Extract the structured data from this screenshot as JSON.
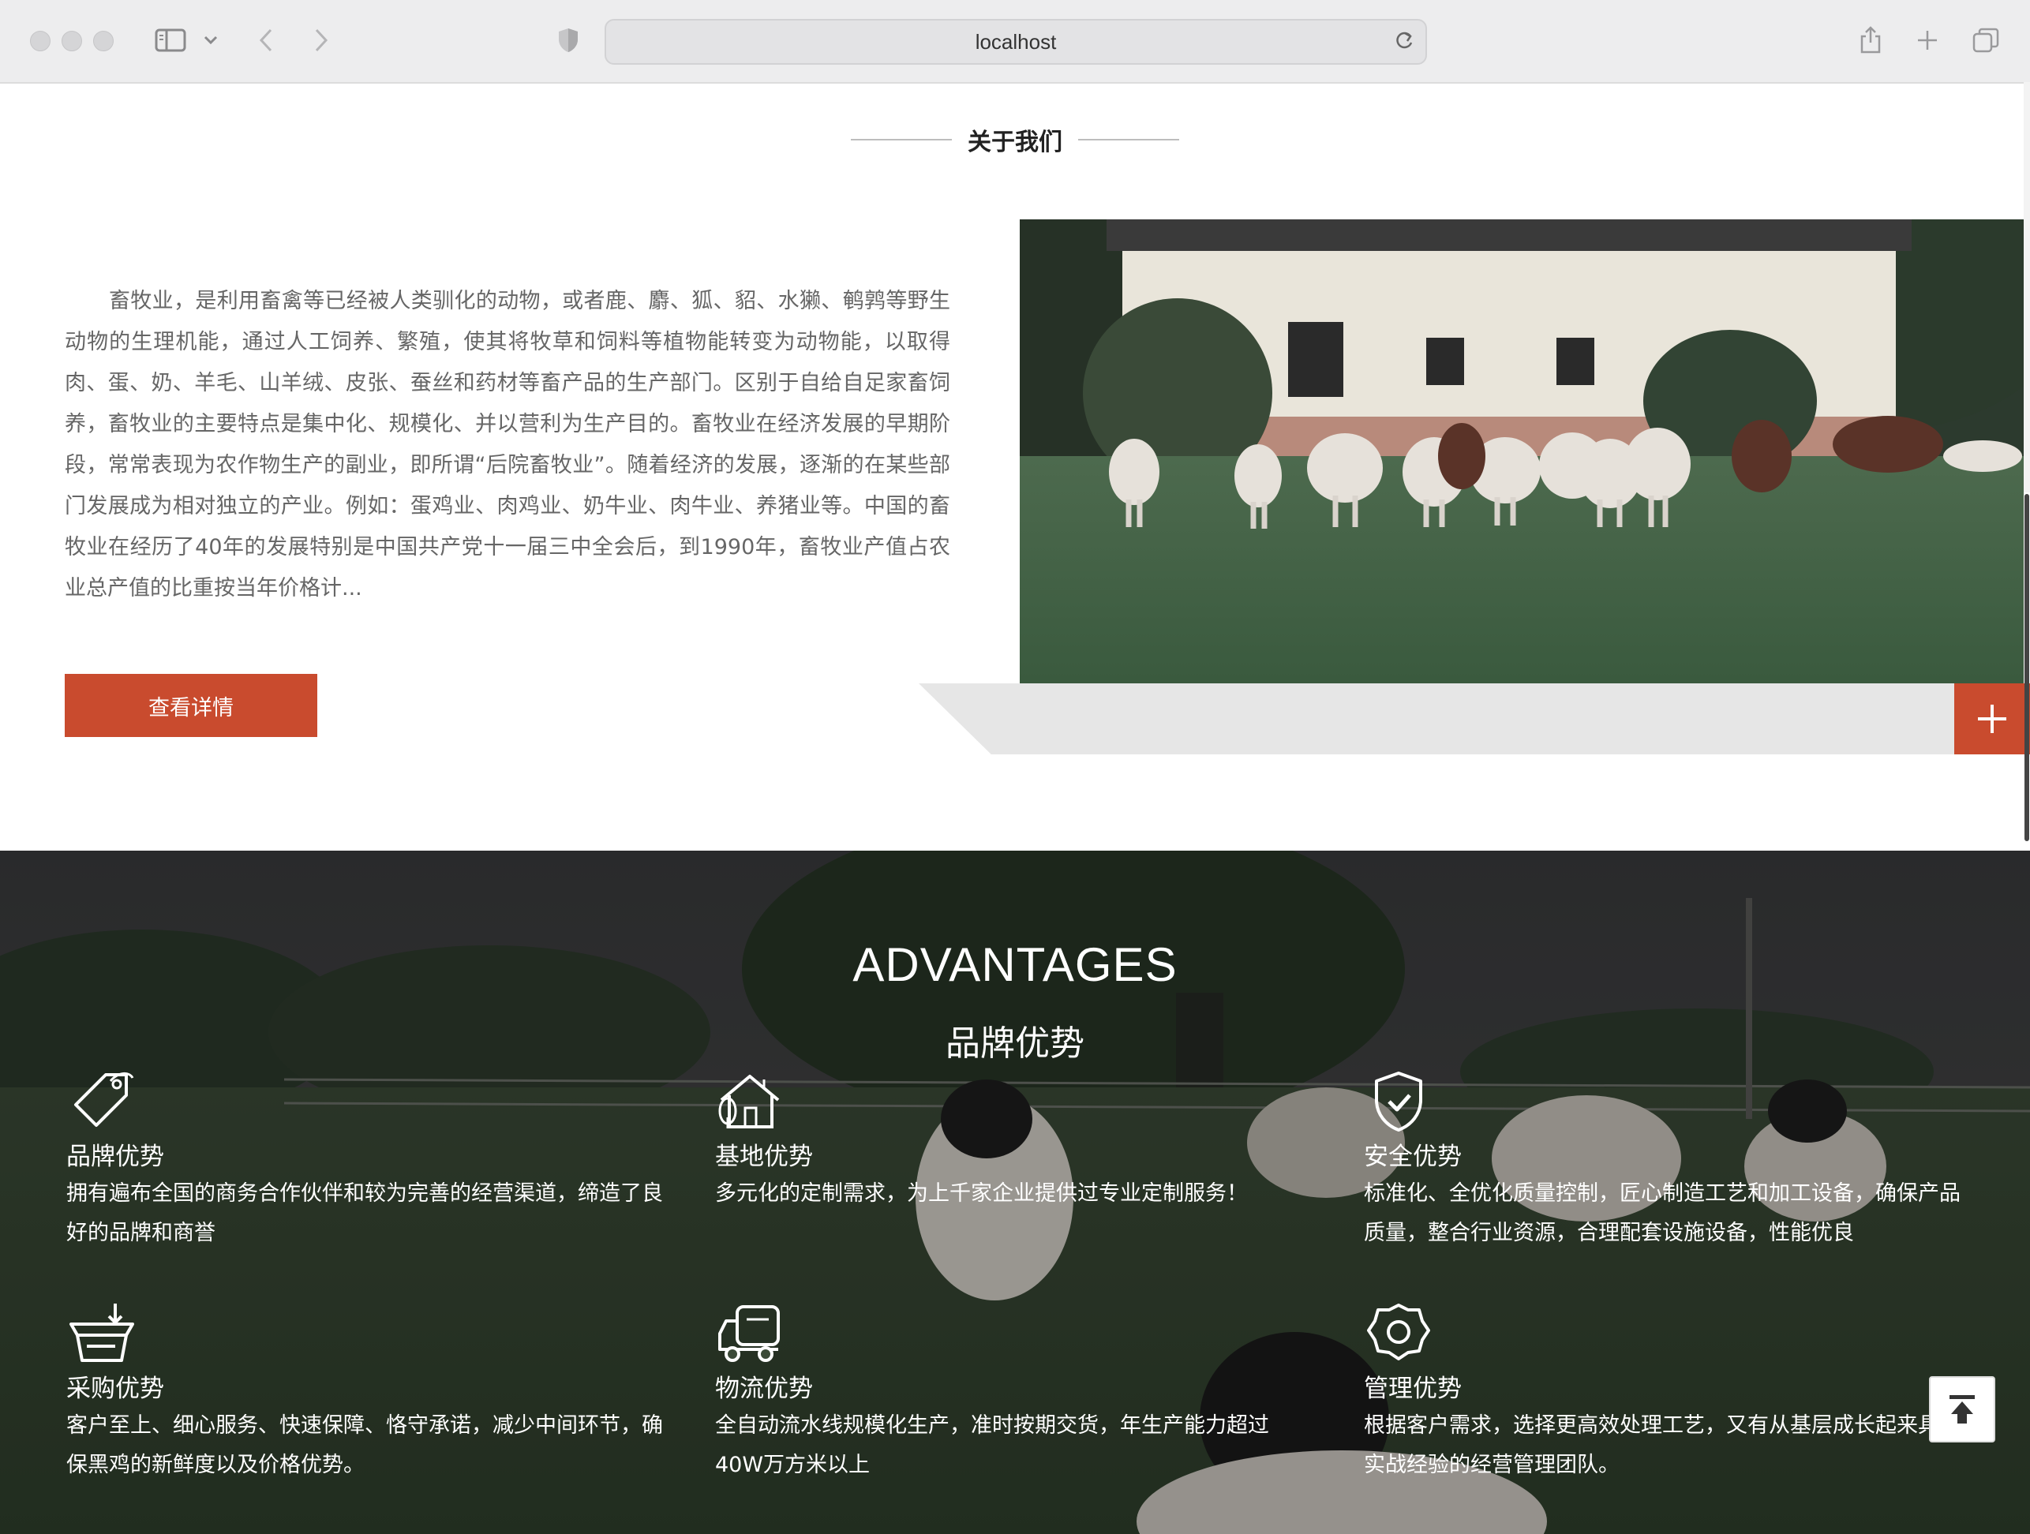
{
  "browser": {
    "url": "localhost",
    "icons": [
      "sidebar-icon",
      "chevron-down-icon",
      "back-icon",
      "forward-icon",
      "shield-icon",
      "reload-icon",
      "share-icon",
      "new-tab-icon",
      "tabs-icon"
    ]
  },
  "about": {
    "title": "关于我们",
    "text": "畜牧业，是利用畜禽等已经被人类驯化的动物，或者鹿、麝、狐、貂、水獭、鹌鹑等野生动物的生理机能，通过人工饲养、繁殖，使其将牧草和饲料等植物能转变为动物能，以取得肉、蛋、奶、羊毛、山羊绒、皮张、蚕丝和药材等畜产品的生产部门。区别于自给自足家畜饲养，畜牧业的主要特点是集中化、规模化、并以营利为生产目的。畜牧业在经济发展的早期阶段，常常表现为农作物生产的副业，即所谓“后院畜牧业”。随着经济的发展，逐渐的在某些部门发展成为相对独立的产业。例如：蛋鸡业、肉鸡业、奶牛业、肉牛业、养猪业等。中国的畜牧业在经历了40年的发展特别是中国共产党十一届三中全会后，到1990年，畜牧业产值占农业总产值的比重按当年价格计...",
    "button": "查看详情",
    "image": "sheep-flock-photo",
    "plus_icon": "plus-icon"
  },
  "advantages": {
    "title": "ADVANTAGES",
    "subtitle": "品牌优势",
    "items": [
      {
        "icon": "tag-icon",
        "name": "品牌优势",
        "desc": "拥有遍布全国的商务合作伙伴和较为完善的经营渠道，缔造了良好的品牌和商誉"
      },
      {
        "icon": "farm-house-icon",
        "name": "基地优势",
        "desc": "多元化的定制需求，为上千家企业提供过专业定制服务！"
      },
      {
        "icon": "shield-check-icon",
        "name": "安全优势",
        "desc": "标准化、全优化质量控制，匠心制造工艺和加工设备，确保产品质量，整合行业资源，合理配套设施设备，性能优良"
      },
      {
        "icon": "purchase-basket-icon",
        "name": "采购优势",
        "desc": "客户至上、细心服务、快速保障、恪守承诺，减少中间环节，确保黑鸡的新鲜度以及价格优势。"
      },
      {
        "icon": "truck-icon",
        "name": "物流优势",
        "desc": "全自动流水线规模化生产，准时按期交货，年生产能力超过40W万方米以上"
      },
      {
        "icon": "gear-icon",
        "name": "管理优势",
        "desc": "根据客户需求，选择更高效处理工艺，又有从基层成长起来具有实战经验的经营管理团队。"
      }
    ],
    "back_to_top_icon": "back-to-top-icon"
  }
}
